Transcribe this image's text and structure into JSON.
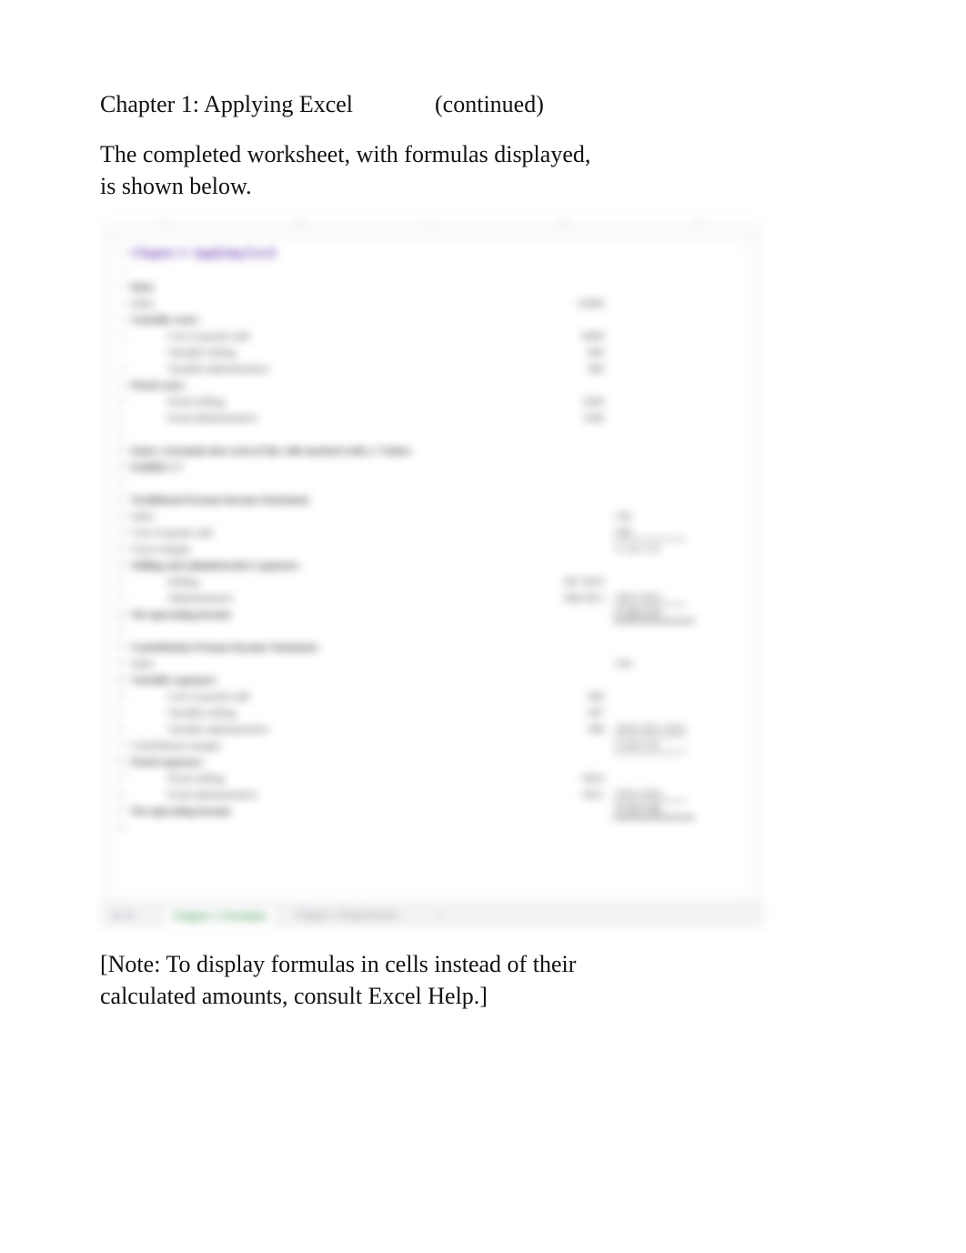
{
  "header": {
    "chapter_title": "Chapter 1: Applying Excel",
    "continued": "(continued)"
  },
  "intro": "The completed worksheet, with formulas displayed, is shown below.",
  "note": "[Note: To display formulas in cells instead of their calculated amounts, consult Excel Help.]",
  "screenshot": {
    "title_cell": "Chapter 1: Applying Excel",
    "columns": [
      "A",
      "B",
      "C",
      "D",
      "E"
    ],
    "data_section": {
      "heading": "Data",
      "lines": [
        {
          "label": "Sales",
          "col_b": "12000"
        },
        {
          "label": "Variable costs:",
          "col_b": ""
        },
        {
          "label": "Cost of goods sold",
          "col_b": "6000",
          "indent": 2
        },
        {
          "label": "Variable selling",
          "col_b": "600",
          "indent": 2
        },
        {
          "label": "Variable administrative",
          "col_b": "400",
          "indent": 2
        },
        {
          "label": "Fixed costs:",
          "col_b": ""
        },
        {
          "label": "Fixed selling",
          "col_b": "2500",
          "indent": 2
        },
        {
          "label": "Fixed administrative",
          "col_b": "1500",
          "indent": 2
        }
      ]
    },
    "instruction": "Enter a formula into each of the cells marked with a ? below",
    "instruction2": "Exhibit 1-7",
    "traditional": {
      "heading": "Traditional Format Income Statement",
      "lines": [
        {
          "label": "Sales",
          "col_c": "=B4"
        },
        {
          "label": "Cost of goods sold",
          "col_c": "=B6"
        },
        {
          "label": "Gross margin",
          "col_c": "=C18-C19",
          "rule": "single"
        },
        {
          "label": "Selling and administrative expenses:",
          "col_c": ""
        },
        {
          "label": "Selling",
          "col_b": "=B7+B10",
          "indent": 2
        },
        {
          "label": "Administrative",
          "col_b": "=B8+B11",
          "indent": 2,
          "col_c": "=B22+B23",
          "rule": "single"
        },
        {
          "label": "Net operating income",
          "col_c": "=C20-C23",
          "rule": "double"
        }
      ]
    },
    "contribution": {
      "heading": "Contribution Format Income Statement",
      "lines": [
        {
          "label": "Sales",
          "col_c": "=B4"
        },
        {
          "label": "Variable expenses:",
          "col_c": ""
        },
        {
          "label": "Cost of goods sold",
          "col_b": "=B6",
          "indent": 2
        },
        {
          "label": "Variable selling",
          "col_b": "=B7",
          "indent": 2
        },
        {
          "label": "Variable administrative",
          "col_b": "=B8",
          "indent": 2,
          "col_c": "=B30+B31+B32",
          "rule": "single"
        },
        {
          "label": "Contribution margin",
          "col_c": "=C28-C32",
          "rule": "single"
        },
        {
          "label": "Fixed expenses:",
          "col_c": ""
        },
        {
          "label": "Fixed selling",
          "col_b": "=B10",
          "indent": 2
        },
        {
          "label": "Fixed administrative",
          "col_b": "=B11",
          "indent": 2,
          "col_c": "=B35+B36",
          "rule": "single"
        },
        {
          "label": "Net operating income",
          "col_c": "=C33-C36",
          "rule": "double"
        }
      ]
    },
    "tabs": {
      "arrows": [
        "◀",
        "▶",
        "…"
      ],
      "active": "Chapter 1 Formulas",
      "others": [
        "Chapter 1 Requirement …",
        "+"
      ]
    }
  }
}
